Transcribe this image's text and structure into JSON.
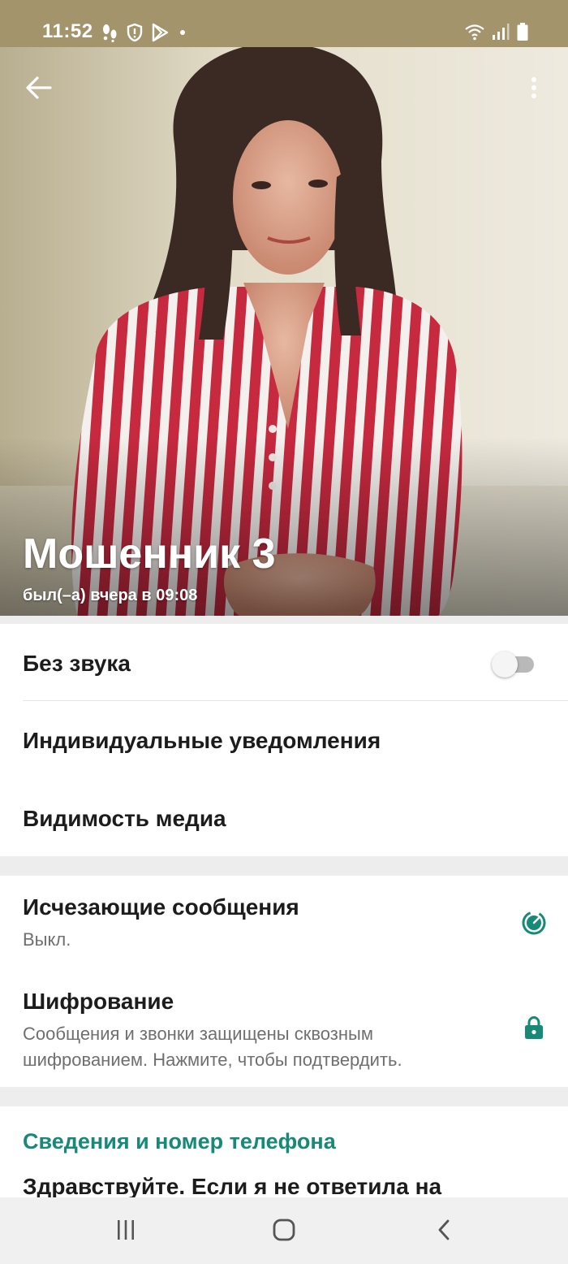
{
  "status_bar": {
    "time": "11:52",
    "icons": [
      "steps-icon",
      "shield-icon",
      "play-store-icon",
      "dot-icon",
      "wifi-icon",
      "signal-icon",
      "battery-icon"
    ]
  },
  "header": {
    "contact_name": "Мошенник 3",
    "last_seen": "был(–а) вчера в 09:08"
  },
  "settings": {
    "mute": {
      "label": "Без звука",
      "enabled": false
    },
    "custom_notifications": {
      "label": "Индивидуальные уведомления"
    },
    "media_visibility": {
      "label": "Видимость медиа"
    }
  },
  "privacy": {
    "disappearing": {
      "label": "Исчезающие сообщения",
      "value": "Выкл."
    },
    "encryption": {
      "label": "Шифрование",
      "line1": "Сообщения и звонки защищены сквозным",
      "line2": "шифрованием. Нажмите, чтобы подтвердить."
    }
  },
  "about": {
    "header": "Сведения и номер телефона",
    "text": "Здравствуйте. Если я не ответила на"
  },
  "colors": {
    "accent": "#168a76",
    "status_bar": "#a3946b"
  }
}
